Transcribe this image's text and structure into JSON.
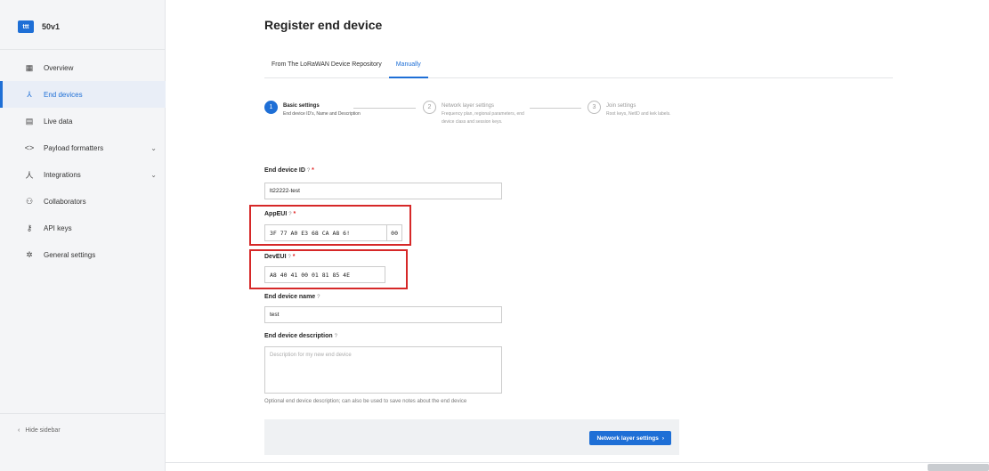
{
  "app": {
    "logo_text": "ttt",
    "name": "50v1"
  },
  "sidebar": {
    "items": [
      {
        "label": "Overview",
        "icon": "grid-icon"
      },
      {
        "label": "End devices",
        "icon": "device-tree-icon"
      },
      {
        "label": "Live data",
        "icon": "list-box-icon"
      },
      {
        "label": "Payload formatters",
        "icon": "code-icon"
      },
      {
        "label": "Integrations",
        "icon": "integration-icon"
      },
      {
        "label": "Collaborators",
        "icon": "people-icon"
      },
      {
        "label": "API keys",
        "icon": "key-icon"
      },
      {
        "label": "General settings",
        "icon": "gear-icon"
      }
    ],
    "hide_label": "Hide sidebar"
  },
  "page": {
    "title": "Register end device"
  },
  "tabs": [
    {
      "label": "From The LoRaWAN Device Repository"
    },
    {
      "label": "Manually"
    }
  ],
  "steps": [
    {
      "num": "1",
      "title": "Basic settings",
      "desc": "End device ID's, Name and Description"
    },
    {
      "num": "2",
      "title": "Network layer settings",
      "desc": "Frequency plan, regional parameters, end device class and session keys."
    },
    {
      "num": "3",
      "title": "Join settings",
      "desc": "Root keys, NetID and kek labels."
    }
  ],
  "form": {
    "device_id": {
      "label": "End device ID",
      "value": "lt22222-test"
    },
    "app_eui": {
      "label": "AppEUI",
      "value": "3F 77 A0 E3 68 CA A8 6!",
      "tail": "00"
    },
    "dev_eui": {
      "label": "DevEUI",
      "value": "A8 40 41 00 01 81 85 4E"
    },
    "name": {
      "label": "End device name",
      "value": "test"
    },
    "description": {
      "label": "End device description",
      "placeholder": "Description for my new end device",
      "hint": "Optional end device description; can also be used to save notes about the end device"
    },
    "help_glyph": "?",
    "required_glyph": "*"
  },
  "footer": {
    "next_label": "Network layer settings",
    "next_arrow": "›"
  },
  "colors": {
    "accent": "#1e6fd6",
    "highlight": "#d62828",
    "sidebar_bg": "#f4f5f7"
  }
}
